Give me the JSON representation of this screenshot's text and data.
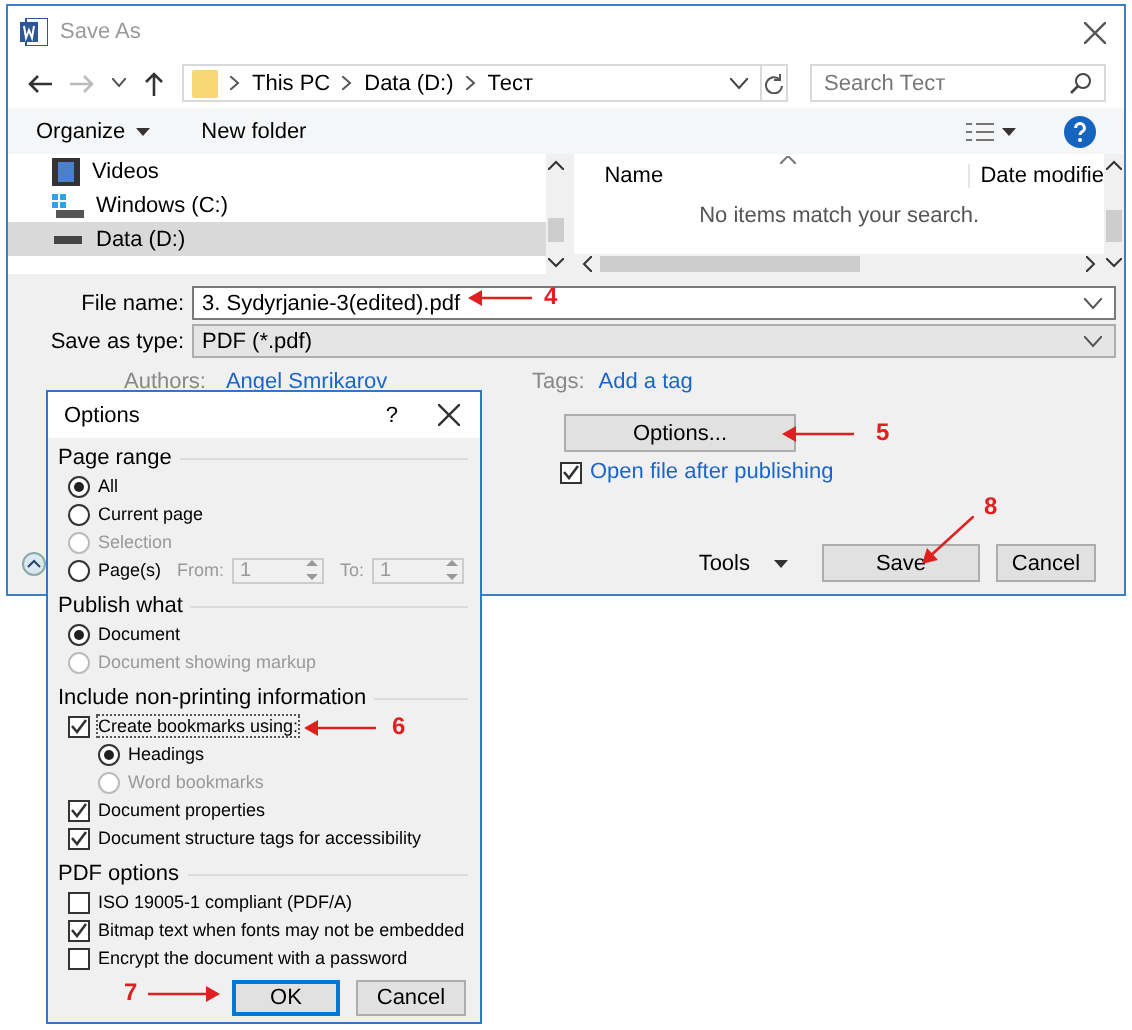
{
  "window": {
    "title": "Save As"
  },
  "address_bar": {
    "path": [
      "This PC",
      "Data (D:)",
      "Тест"
    ]
  },
  "search": {
    "placeholder": "Search Тест"
  },
  "toolbar": {
    "organize": "Organize",
    "new_folder": "New folder"
  },
  "folders": [
    {
      "name": "Videos",
      "kind": "videos",
      "selected": false
    },
    {
      "name": "Windows (C:)",
      "kind": "system-drive",
      "selected": false
    },
    {
      "name": "Data (D:)",
      "kind": "drive",
      "selected": true
    }
  ],
  "file_list": {
    "columns": [
      "Name",
      "Date modifie"
    ],
    "empty_message": "No items match your search."
  },
  "file_name": {
    "label": "File name:",
    "value": "3. Sydyrjanie-3(edited).pdf",
    "annotation": "4"
  },
  "save_as_type": {
    "label": "Save as type:",
    "value": "PDF (*.pdf)"
  },
  "authors": {
    "label": "Authors:",
    "value": "Angel Smrikarov"
  },
  "tags": {
    "label": "Tags:",
    "value": "Add a tag"
  },
  "options_button": {
    "label": "Options...",
    "annotation": "5"
  },
  "open_after_publishing": {
    "label": "Open file after publishing",
    "checked": true
  },
  "tools": {
    "label": "Tools"
  },
  "buttons": [
    {
      "label": "Save",
      "annotation": "8"
    },
    {
      "label": "Cancel"
    }
  ],
  "options_dialog": {
    "title": "Options",
    "help": "?",
    "sections": [
      {
        "title": "Page range",
        "items": [
          {
            "kind": "radio",
            "label": "All",
            "selected": true,
            "disabled": false
          },
          {
            "kind": "radio",
            "label": "Current page",
            "selected": false,
            "disabled": false
          },
          {
            "kind": "radio",
            "label": "Selection",
            "selected": false,
            "disabled": true
          },
          {
            "kind": "page-range",
            "label": "Page(s)",
            "selected": false,
            "disabled": false,
            "from_label": "From:",
            "from_value": "1",
            "to_label": "To:",
            "to_value": "1"
          }
        ]
      },
      {
        "title": "Publish what",
        "items": [
          {
            "kind": "radio",
            "label": "Document",
            "selected": true,
            "disabled": false
          },
          {
            "kind": "radio",
            "label": "Document showing markup",
            "selected": false,
            "disabled": true
          }
        ]
      },
      {
        "title": "Include non-printing information",
        "items": [
          {
            "kind": "checkbox",
            "label": "Create bookmarks using:",
            "checked": true,
            "focused": true,
            "annotation": "6",
            "children": [
              {
                "kind": "radio",
                "label": "Headings",
                "selected": true,
                "disabled": false
              },
              {
                "kind": "radio",
                "label": "Word bookmarks",
                "selected": false,
                "disabled": true
              }
            ]
          },
          {
            "kind": "checkbox",
            "label": "Document properties",
            "checked": true
          },
          {
            "kind": "checkbox",
            "label": "Document structure tags for accessibility",
            "checked": true
          }
        ]
      },
      {
        "title": "PDF options",
        "items": [
          {
            "kind": "checkbox",
            "label": "ISO 19005-1 compliant (PDF/A)",
            "checked": false
          },
          {
            "kind": "checkbox",
            "label": "Bitmap text when fonts may not be embedded",
            "checked": true
          },
          {
            "kind": "checkbox",
            "label": "Encrypt the document with a password",
            "checked": false
          }
        ]
      }
    ],
    "buttons": [
      {
        "label": "OK",
        "default": true,
        "annotation": "7"
      },
      {
        "label": "Cancel",
        "default": false
      }
    ]
  }
}
